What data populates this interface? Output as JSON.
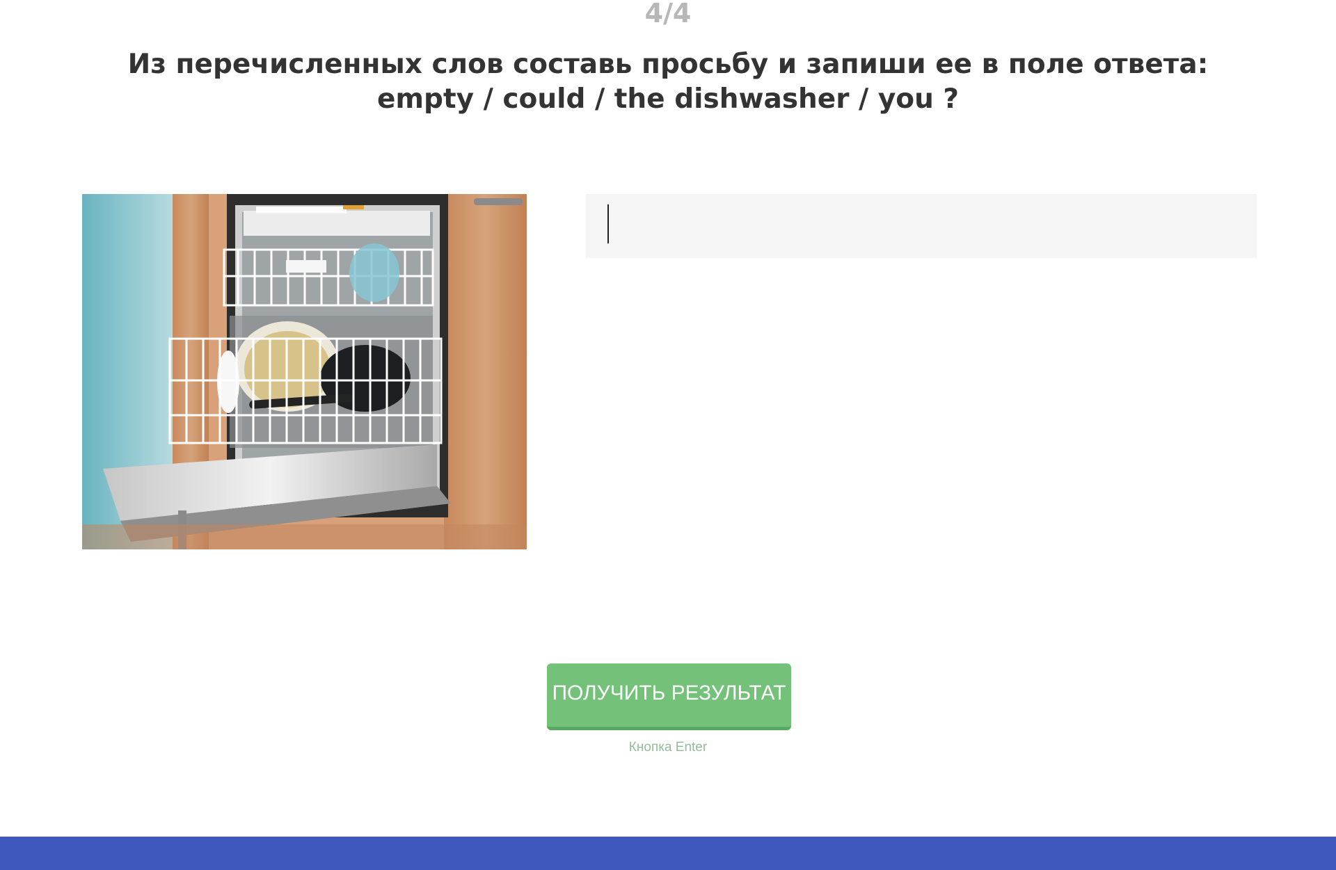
{
  "quiz": {
    "progress": "4/4",
    "question": "Из перечисленных слов составь просьбу и запиши ее в поле ответа: empty / could / the dishwasher / you ?",
    "answer_value": "",
    "answer_placeholder": "",
    "submit_label": "ПОЛУЧИТЬ РЕЗУЛЬТАТ",
    "submit_hint": "Кнопка Enter"
  },
  "colors": {
    "button": "#74c27a",
    "footer": "#3f58bd",
    "hint": "#93bd97",
    "progress": "#b7b7b7"
  },
  "image": {
    "subject": "open-dishwasher-photo"
  }
}
